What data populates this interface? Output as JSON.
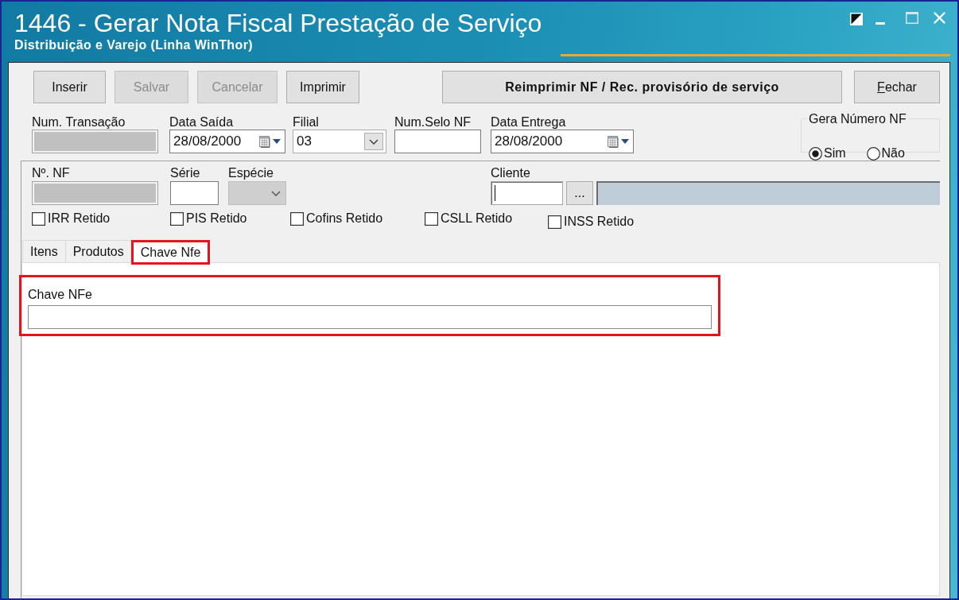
{
  "window": {
    "title": "1446 - Gerar Nota Fiscal Prestação de Serviço",
    "subtitle": "Distribuição e Varejo (Linha WinThor)"
  },
  "toolbar": [
    {
      "label": "Inserir",
      "kind": "standard",
      "disabled": false
    },
    {
      "label": "Salvar",
      "kind": "standard",
      "disabled": true
    },
    {
      "label": "Cancelar",
      "kind": "standard",
      "disabled": true
    },
    {
      "label": "Imprimir",
      "kind": "standard",
      "disabled": false
    },
    {
      "label": "Reimprimir NF / Rec. provisório de serviço",
      "kind": "wide",
      "disabled": false
    },
    {
      "label": "Fechar",
      "kind": "close",
      "disabled": false,
      "mnemonic": true
    }
  ],
  "header_fields": [
    {
      "label": "Num. Transação",
      "kind": "text",
      "disabled": true
    },
    {
      "label": "Data Saída",
      "kind": "date",
      "value": "28/08/2000",
      "disabled": false
    },
    {
      "label": "Filial",
      "kind": "combo",
      "value": "03",
      "disabled": false
    },
    {
      "label": "Num.Selo NF",
      "kind": "text",
      "disabled": false
    },
    {
      "label": "Data Entrega",
      "kind": "date",
      "value": "28/08/2000",
      "disabled": false
    }
  ],
  "gera_numero_nf": {
    "title": "Gera Número NF",
    "options": [
      {
        "label": "Sim",
        "selected": true
      },
      {
        "label": "Não",
        "selected": false
      }
    ]
  },
  "nf_fields": [
    {
      "label": "Nº. NF",
      "kind": "text",
      "disabled": true
    },
    {
      "label": "Série",
      "kind": "text",
      "disabled": false
    },
    {
      "label": "Espécie",
      "kind": "combo",
      "disabled": true
    }
  ],
  "cliente": {
    "label": "Cliente",
    "focused": true,
    "lookup_button": "..."
  },
  "retentions": [
    {
      "label": "IRR Retido",
      "checked": false
    },
    {
      "label": "PIS Retido",
      "checked": false
    },
    {
      "label": "Cofins Retido",
      "checked": false
    },
    {
      "label": "CSLL Retido",
      "checked": false
    },
    {
      "label": "INSS Retido",
      "checked": false
    }
  ],
  "tabs": [
    {
      "label": "Itens",
      "selected": false,
      "highlighted": false
    },
    {
      "label": "Produtos",
      "selected": false,
      "highlighted": false
    },
    {
      "label": "Chave Nfe",
      "selected": true,
      "highlighted": true
    }
  ],
  "chave_nfe": {
    "label": "Chave NFe",
    "highlighted": true
  }
}
